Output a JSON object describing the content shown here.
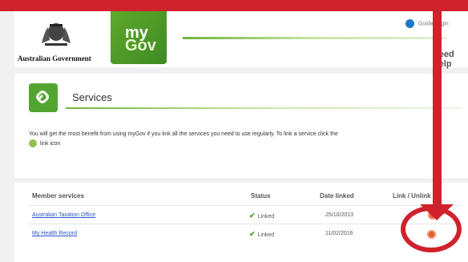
{
  "header": {
    "gov_label": "Australian Government",
    "logo_line1": "my",
    "logo_line2": "Gov",
    "top_links": "Guide   Login",
    "need_help": "need help"
  },
  "services": {
    "title": "Services",
    "info_text": "You will get the most benefit from using myGov if you link all the services you need to use regularly. To link a service click the",
    "info_text2": "link icon"
  },
  "table": {
    "headers": {
      "member_services": "Member services",
      "status": "Status",
      "date_linked": "Date linked",
      "link_unlink": "Link / Unlink"
    },
    "rows": [
      {
        "service": "Australian Taxation Office",
        "status": "Linked",
        "date": "25/10/2013"
      },
      {
        "service": "My Health Record",
        "status": "Linked",
        "date": "11/02/2016"
      }
    ]
  },
  "colors": {
    "annotation_red": "#d0222c",
    "mygov_green": "#4f9e26",
    "link_blue": "#2a54c6",
    "unlink_orange": "#e65c32"
  }
}
